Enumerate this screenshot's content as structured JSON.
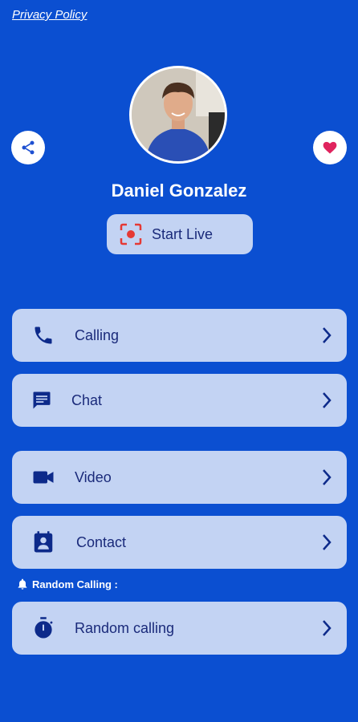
{
  "privacy_policy": "Privacy Policy",
  "profile": {
    "name": "Daniel Gonzalez"
  },
  "start_live": {
    "label": "Start Live"
  },
  "menu": {
    "calling": "Calling",
    "chat": "Chat",
    "video": "Video",
    "contact": "Contact"
  },
  "random_section": {
    "title": "Random Calling :",
    "item": "Random calling"
  },
  "colors": {
    "background": "#0b4fd1",
    "card": "#c3d3f3",
    "icon": "#0d2a8a",
    "heart": "#e0245e",
    "record": "#e53935"
  },
  "icons": [
    "share-icon",
    "heart-icon",
    "record-icon",
    "phone-icon",
    "chat-icon",
    "video-icon",
    "contact-icon",
    "bell-icon",
    "stopwatch-icon",
    "chevron-right-icon"
  ]
}
